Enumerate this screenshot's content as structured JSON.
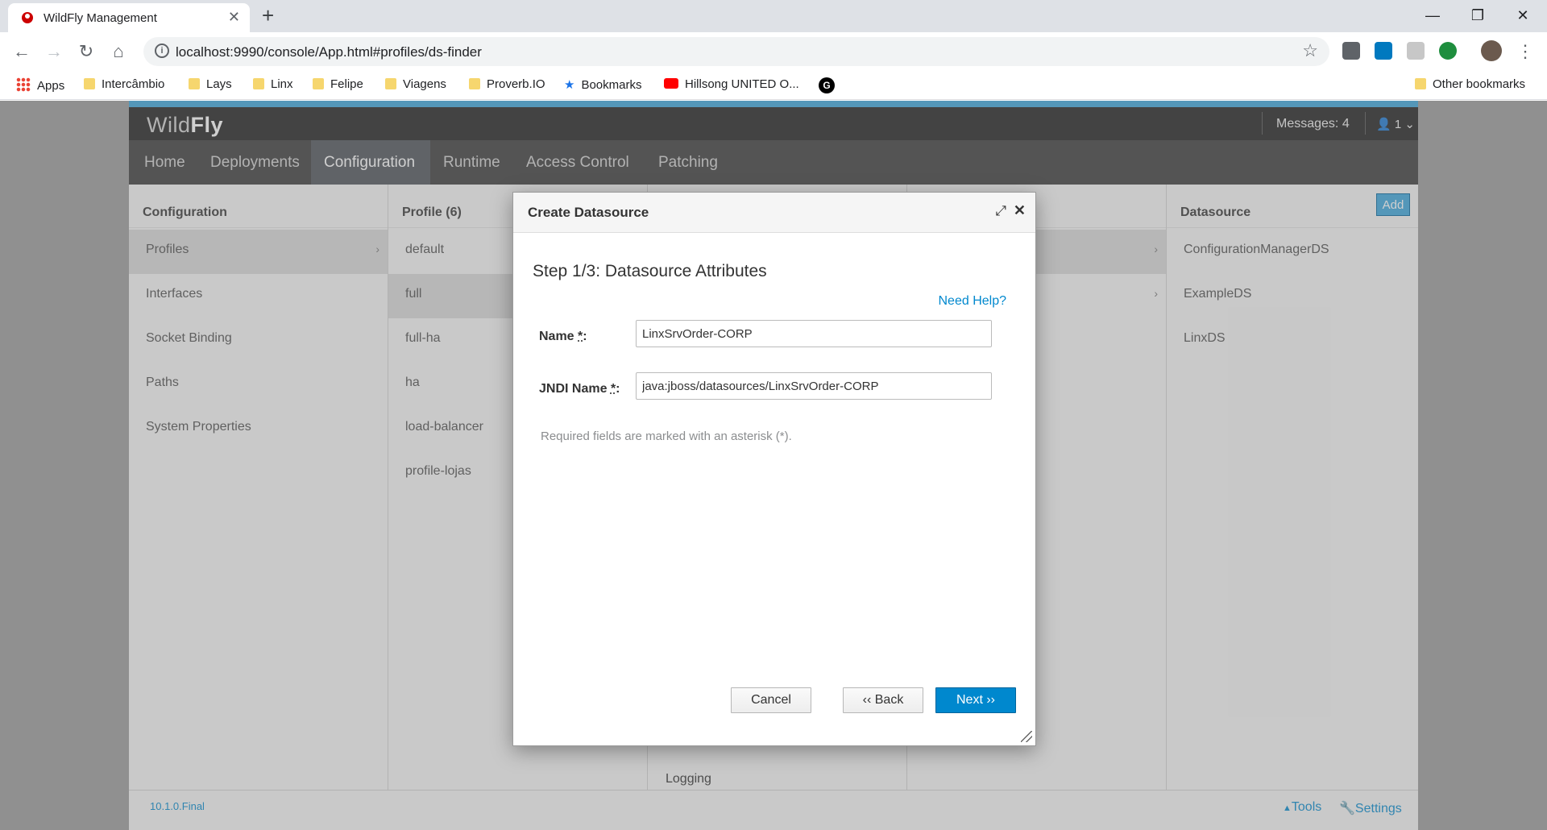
{
  "browser": {
    "tab_title": "WildFly Management",
    "tab_close": "✕",
    "new_tab": "+",
    "url": "localhost:9990/console/App.html#profiles/ds-finder",
    "window_controls": [
      "—",
      "❐",
      "✕"
    ]
  },
  "bookmarks": {
    "items": [
      "Apps",
      "Intercâmbio",
      "Lays",
      "Linx",
      "Felipe",
      "Viagens",
      "Proverb.IO",
      "Bookmarks",
      "Hillsong UNITED O...",
      "G"
    ],
    "other": "Other bookmarks"
  },
  "wildfly": {
    "logo_light": "Wild",
    "logo_bold": "Fly",
    "messages": "Messages: 4",
    "user": "1",
    "nav": [
      "Home",
      "Deployments",
      "Configuration",
      "Runtime",
      "Access Control",
      "Patching"
    ],
    "active_nav": "Configuration",
    "columns": {
      "configuration": {
        "header": "Configuration",
        "items": [
          "Profiles",
          "Interfaces",
          "Socket Binding",
          "Paths",
          "System Properties"
        ]
      },
      "profile": {
        "header": "Profile (6)",
        "items": [
          "default",
          "full",
          "full-ha",
          "ha",
          "load-balancer",
          "profile-lojas"
        ]
      },
      "subsystem_partial": "Logging",
      "datasource": {
        "header": "Datasource",
        "add_label": "Add",
        "items": [
          "ConfigurationManagerDS",
          "ExampleDS",
          "LinxDS"
        ]
      }
    },
    "footer": {
      "version": "10.1.0.Final",
      "tools": "Tools",
      "settings": "Settings"
    }
  },
  "dialog": {
    "title": "Create Datasource",
    "step": "Step 1/3: Datasource Attributes",
    "help": "Need Help?",
    "name_label": "Name",
    "name_value": "LinxSrvOrder-CORP",
    "jndi_label": "JNDI Name",
    "jndi_value": "java:jboss/datasources/LinxSrvOrder-CORP",
    "required_asterisk": "*",
    "required_note": "Required fields are marked with an asterisk (*).",
    "cancel": "Cancel",
    "back": "‹‹ Back",
    "next": "Next ››"
  },
  "colors": {
    "accent": "#0088ce",
    "add_button": "#39a5dc",
    "header_bg": "#1d1d1d",
    "nav_bg": "#393939"
  }
}
